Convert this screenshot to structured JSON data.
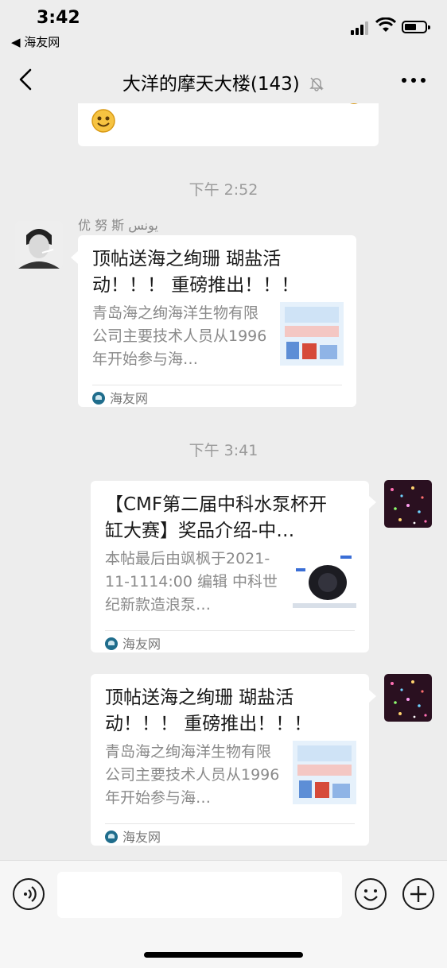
{
  "status_bar": {
    "time": "3:42",
    "back_app": "◀ 海友网"
  },
  "header": {
    "title": "大洋的摩天大楼(143)"
  },
  "messages": {
    "partial_text": "，……，…………………",
    "timestamps": [
      "下午 2:52",
      "下午 3:41"
    ],
    "incoming_card": {
      "sender": "优 努 斯  يونس",
      "title": "顶帖送海之绚珊 瑚盐活动！！！ 重磅推出！！！",
      "description": "青岛海之绚海洋生物有限公司主要技术人员从1996年开始参与海…",
      "source": "海友网"
    },
    "outgoing_cards": [
      {
        "title": "【CMF第二届中科水泵杯开缸大赛】奖品介绍-中…",
        "description": "本帖最后由飒枫于2021-11-1114:00 编辑 中科世纪新款造浪泵…",
        "source": "海友网"
      },
      {
        "title": "顶帖送海之绚珊 瑚盐活动！！！ 重磅推出！！！",
        "description": "青岛海之绚海洋生物有限公司主要技术人员从1996年开始参与海…",
        "source": "海友网"
      }
    ]
  },
  "input_bar": {
    "placeholder": ""
  },
  "colors": {
    "background": "#ededed",
    "bubble": "#ffffff",
    "timestamp": "#9a9a9a"
  }
}
